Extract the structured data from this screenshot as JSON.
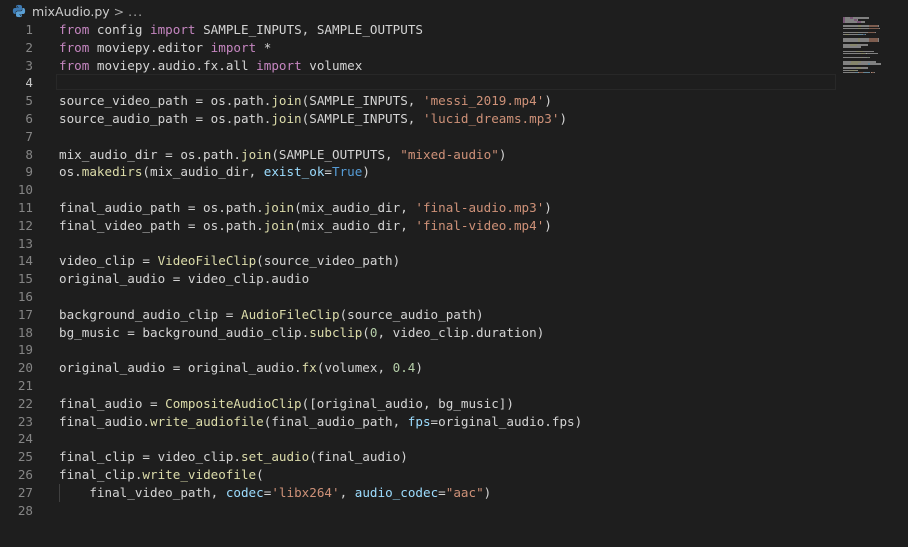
{
  "breadcrumb": {
    "file_icon": "python-icon",
    "file_name": "mixAudio.py",
    "separator": ">",
    "more": "..."
  },
  "editor": {
    "active_line": 4,
    "lines": [
      {
        "n": "1",
        "tokens": [
          [
            "from",
            "kw"
          ],
          [
            " config ",
            ""
          ],
          [
            "import",
            "kw"
          ],
          [
            " SAMPLE_INPUTS, SAMPLE_OUTPUTS",
            ""
          ]
        ]
      },
      {
        "n": "2",
        "tokens": [
          [
            "from",
            "kw"
          ],
          [
            " moviepy.editor ",
            ""
          ],
          [
            "import",
            "kw"
          ],
          [
            " *",
            ""
          ]
        ]
      },
      {
        "n": "3",
        "tokens": [
          [
            "from",
            "kw"
          ],
          [
            " moviepy.audio.fx.all ",
            ""
          ],
          [
            "import",
            "kw"
          ],
          [
            " volumex",
            ""
          ]
        ]
      },
      {
        "n": "4",
        "tokens": []
      },
      {
        "n": "5",
        "tokens": [
          [
            "source_video_path = os.path.",
            ""
          ],
          [
            "join",
            "fn"
          ],
          [
            "(SAMPLE_INPUTS, ",
            ""
          ],
          [
            "'messi_2019.mp4'",
            "str"
          ],
          [
            ")",
            ""
          ]
        ]
      },
      {
        "n": "6",
        "tokens": [
          [
            "source_audio_path = os.path.",
            ""
          ],
          [
            "join",
            "fn"
          ],
          [
            "(SAMPLE_INPUTS, ",
            ""
          ],
          [
            "'lucid_dreams.mp3'",
            "str"
          ],
          [
            ")",
            ""
          ]
        ]
      },
      {
        "n": "7",
        "tokens": []
      },
      {
        "n": "8",
        "tokens": [
          [
            "mix_audio_dir = os.path.",
            ""
          ],
          [
            "join",
            "fn"
          ],
          [
            "(SAMPLE_OUTPUTS, ",
            ""
          ],
          [
            "\"mixed-audio\"",
            "str"
          ],
          [
            ")",
            ""
          ]
        ]
      },
      {
        "n": "9",
        "tokens": [
          [
            "os.",
            ""
          ],
          [
            "makedirs",
            "fn"
          ],
          [
            "(mix_audio_dir, ",
            ""
          ],
          [
            "exist_ok",
            "prm"
          ],
          [
            "=",
            ""
          ],
          [
            "True",
            "cst"
          ],
          [
            ")",
            ""
          ]
        ]
      },
      {
        "n": "10",
        "tokens": []
      },
      {
        "n": "11",
        "tokens": [
          [
            "final_audio_path = os.path.",
            ""
          ],
          [
            "join",
            "fn"
          ],
          [
            "(mix_audio_dir, ",
            ""
          ],
          [
            "'final-audio.mp3'",
            "str"
          ],
          [
            ")",
            ""
          ]
        ]
      },
      {
        "n": "12",
        "tokens": [
          [
            "final_video_path = os.path.",
            ""
          ],
          [
            "join",
            "fn"
          ],
          [
            "(mix_audio_dir, ",
            ""
          ],
          [
            "'final-video.mp4'",
            "str"
          ],
          [
            ")",
            ""
          ]
        ]
      },
      {
        "n": "13",
        "tokens": []
      },
      {
        "n": "14",
        "tokens": [
          [
            "video_clip = ",
            ""
          ],
          [
            "VideoFileClip",
            "fn"
          ],
          [
            "(source_video_path)",
            ""
          ]
        ]
      },
      {
        "n": "15",
        "tokens": [
          [
            "original_audio = video_clip.audio",
            ""
          ]
        ]
      },
      {
        "n": "16",
        "tokens": []
      },
      {
        "n": "17",
        "tokens": [
          [
            "background_audio_clip = ",
            ""
          ],
          [
            "AudioFileClip",
            "fn"
          ],
          [
            "(source_audio_path)",
            ""
          ]
        ]
      },
      {
        "n": "18",
        "tokens": [
          [
            "bg_music = background_audio_clip.",
            ""
          ],
          [
            "subclip",
            "fn"
          ],
          [
            "(",
            ""
          ],
          [
            "0",
            "num"
          ],
          [
            ", video_clip.duration)",
            ""
          ]
        ]
      },
      {
        "n": "19",
        "tokens": []
      },
      {
        "n": "20",
        "tokens": [
          [
            "original_audio = original_audio.",
            ""
          ],
          [
            "fx",
            "fn"
          ],
          [
            "(volumex, ",
            ""
          ],
          [
            "0.4",
            "num"
          ],
          [
            ")",
            ""
          ]
        ]
      },
      {
        "n": "21",
        "tokens": []
      },
      {
        "n": "22",
        "tokens": [
          [
            "final_audio = ",
            ""
          ],
          [
            "CompositeAudioClip",
            "fn"
          ],
          [
            "([original_audio, bg_music])",
            ""
          ]
        ]
      },
      {
        "n": "23",
        "tokens": [
          [
            "final_audio.",
            ""
          ],
          [
            "write_audiofile",
            "fn"
          ],
          [
            "(final_audio_path, ",
            ""
          ],
          [
            "fps",
            "prm"
          ],
          [
            "=original_audio.fps)",
            ""
          ]
        ]
      },
      {
        "n": "24",
        "tokens": []
      },
      {
        "n": "25",
        "tokens": [
          [
            "final_clip = video_clip.",
            ""
          ],
          [
            "set_audio",
            "fn"
          ],
          [
            "(final_audio)",
            ""
          ]
        ]
      },
      {
        "n": "26",
        "tokens": [
          [
            "final_clip.",
            ""
          ],
          [
            "write_videofile",
            "fn"
          ],
          [
            "(",
            ""
          ]
        ]
      },
      {
        "n": "27",
        "indent": true,
        "tokens": [
          [
            "    final_video_path, ",
            ""
          ],
          [
            "codec",
            "prm"
          ],
          [
            "=",
            ""
          ],
          [
            "'libx264'",
            "str"
          ],
          [
            ", ",
            ""
          ],
          [
            "audio_codec",
            "prm"
          ],
          [
            "=",
            ""
          ],
          [
            "\"aac\"",
            "str"
          ],
          [
            ")",
            ""
          ]
        ]
      },
      {
        "n": "28",
        "tokens": []
      }
    ]
  },
  "colors": {
    "background": "#1e1e1e",
    "keyword": "#c586c0",
    "function": "#dcdcaa",
    "string": "#ce9178",
    "parameter": "#9cdcfe",
    "constant": "#569cd6",
    "number": "#b5cea8",
    "default": "#d4d4d4",
    "line_number": "#858585"
  }
}
